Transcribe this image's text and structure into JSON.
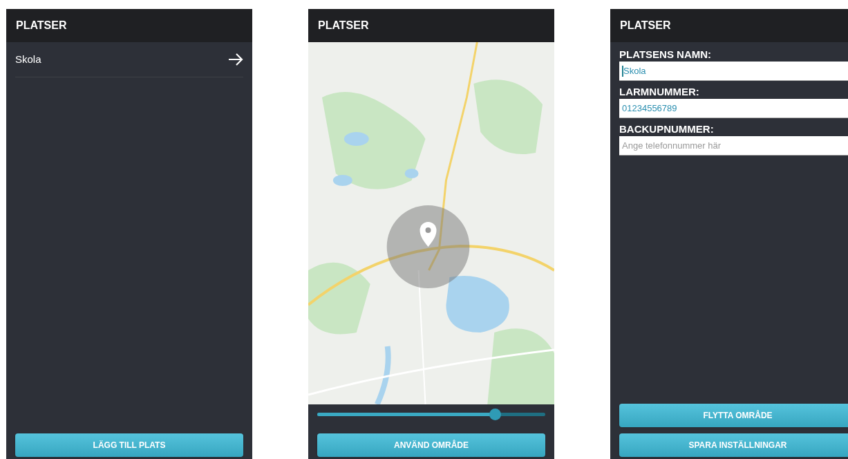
{
  "screens": [
    {
      "kind": "list",
      "title": "PLATSER",
      "items": [
        {
          "label": "Skola"
        }
      ],
      "button": "LÄGG TILL PLATS"
    },
    {
      "kind": "map",
      "title": "PLATSER",
      "radius": {
        "level": 0.78
      },
      "button": "ANVÄND OMRÅDE"
    },
    {
      "kind": "form",
      "title": "PLATSER",
      "fields": [
        {
          "label": "PLATSENS NAMN:",
          "value": "Skola",
          "focused": true
        },
        {
          "label": "LARMNUMMER:",
          "value": "01234556789",
          "focused": false
        },
        {
          "label": "BACKUPNUMMER:",
          "placeholder": "Ange telefonnummer här",
          "focused": false
        }
      ],
      "buttons": [
        "FLYTTA OMRÅDE",
        "SPARA INSTÄLLNINGAR"
      ]
    }
  ]
}
